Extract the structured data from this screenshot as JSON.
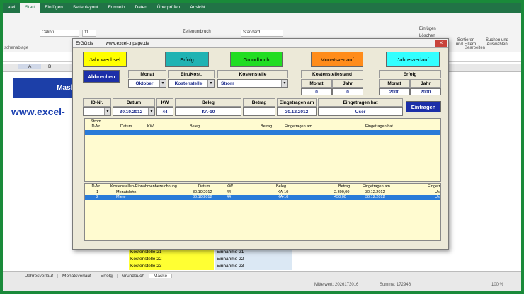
{
  "ribbon": {
    "tabs": [
      "atei",
      "Start",
      "Einfügen",
      "Seitenlayout",
      "Formeln",
      "Daten",
      "Überprüfen",
      "Ansicht"
    ],
    "font_name": "Calibri",
    "font_size": "11",
    "wrap_label": "Zeilenumbruch",
    "number_format": "Standard",
    "clipboard_group": "schenablage",
    "edit_group": "Bearbeiten",
    "insert_label": "Einfügen",
    "delete_label": "Löschen",
    "sort_label": "Sortieren und Filtern",
    "find_label": "Suchen und Auswählen"
  },
  "sheet": {
    "col_a": "A",
    "col_b": "B",
    "maske_label": "Maske",
    "url_text": "www.excel-",
    "bg_rows": [
      {
        "a": "Kostenstelle 21",
        "b": "Einnahme 21"
      },
      {
        "a": "Kostenstelle 22",
        "b": "Einnahme 22"
      },
      {
        "a": "Kostenstelle 23",
        "b": "Einnahme 23"
      }
    ]
  },
  "sheet_tabs": [
    "Jahresverlauf",
    "Monatsverlauf",
    "Erfolg",
    "Grundbuch",
    "Maske"
  ],
  "status": {
    "mittelwert": "Mittelwert: 2026173016",
    "summe": "Summe: 172946",
    "zoom": "100 %"
  },
  "dialog": {
    "title": "ErGGxls",
    "url": "www.excel-.npage.de",
    "close": "×",
    "buttons": {
      "jahr_wechsel": "Jahr wechsel",
      "erfolg": "Erfolg",
      "grundbuch": "Grundbuch",
      "monatsverlauf": "Monatsverlauf",
      "jahresverlauf": "Jahresverlauf",
      "abbrechen": "Abbrechen",
      "eintragen": "Eintragen"
    },
    "filter": {
      "monat_label": "Monat",
      "monat_value": "Oktober",
      "einkost_label": "Ein./Kost.",
      "einkost_value": "Kostenstelle",
      "kostenstelle_label": "Kostenstelle",
      "kostenstelle_value": "Strom",
      "kstand_label": "Kostenstellestand",
      "kstand_monat_label": "Monat",
      "kstand_jahr_label": "Jahr",
      "kstand_monat": "0",
      "kstand_jahr": "0",
      "erfolg_label": "Erfolg",
      "erfolg_monat_label": "Monat",
      "erfolg_jahr_label": "Jahr",
      "erfolg_monat": "2000",
      "erfolg_jahr": "2000"
    },
    "entry": {
      "id_label": "ID-Nr.",
      "datum_label": "Datum",
      "kw_label": "KW",
      "beleg_label": "Beleg",
      "betrag_label": "Betrag",
      "eingetragen_am_label": "Eingetragen am",
      "eingetragen_hat_label": "Eingetragen hat",
      "id_value": "",
      "datum_value": "30.10.2012",
      "kw_value": "44",
      "beleg_value": "KA-10",
      "betrag_value": "",
      "eingetragen_am_value": "30.12.2012",
      "eingetragen_hat_value": "User"
    },
    "list1": {
      "group": "Strom",
      "headers": [
        "ID-Nr.",
        "Datum",
        "KW",
        "Beleg",
        "Betrag",
        "Eingetragen am",
        "Eingetragen hat"
      ]
    },
    "list2": {
      "headers": [
        "ID-Nr.",
        "Kostenstellen-Einnahmenbezeichnung",
        "Datum",
        "KW",
        "Beleg",
        "Betrag",
        "Eingetragen am",
        "Eingetr"
      ],
      "rows": [
        {
          "id": "1",
          "name": "Monatslohn",
          "datum": "30.10.2012",
          "kw": "44",
          "beleg": "KA-10",
          "betrag": "2.300,00",
          "am": "30.12.2012",
          "hat": "Us"
        },
        {
          "id": "2",
          "name": "Miete",
          "datum": "30.10.2012",
          "kw": "44",
          "beleg": "KA-10",
          "betrag": "450,00",
          "am": "30.12.2012",
          "hat": "Us"
        }
      ]
    }
  },
  "colors": {
    "jahr_wechsel": "#ffff00",
    "erfolg": "#1fb3b3",
    "grundbuch": "#22dd22",
    "monatsverlauf": "#ff8c1a",
    "jahresverlauf": "#33ffff",
    "blue_button": "#1c2fa8"
  }
}
